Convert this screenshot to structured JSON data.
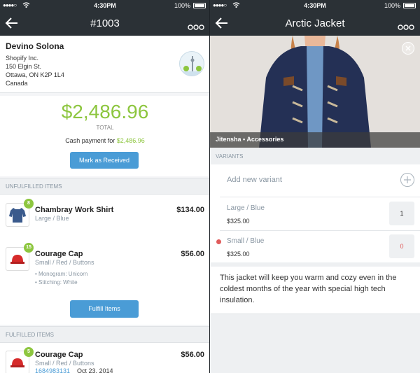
{
  "status": {
    "time": "4:30PM",
    "battery": "100%"
  },
  "left": {
    "nav_title": "#1003",
    "customer": {
      "name": "Devino Solona",
      "company": "Shopify Inc.",
      "street": "150 Elgin St.",
      "city": "Ottawa, ON K2P 1L4",
      "country": "Canada"
    },
    "total_amount": "$2,486.96",
    "total_label": "TOTAL",
    "cash_prefix": "Cash payment for",
    "cash_amount": "$2,486.96",
    "mark_received_label": "Mark as Received",
    "unfulfilled_heading": "UNFULFILLED ITEMS",
    "unfulfilled": [
      {
        "qty": "8",
        "name": "Chambray Work Shirt",
        "price": "$134.00",
        "variant": "Large / Blue"
      },
      {
        "qty": "15",
        "name": "Courage Cap",
        "price": "$56.00",
        "variant": "Small / Red / Buttons",
        "monogram": "• Monogram: Unicorn",
        "stitching": "• Stitching: White"
      }
    ],
    "fulfill_label": "Fulfill Items",
    "fulfilled_heading": "FULFILLED ITEMS",
    "fulfilled": [
      {
        "qty": "5",
        "name": "Courage Cap",
        "price": "$56.00",
        "variant": "Small / Red / Buttons",
        "tracking": "1684983131",
        "date": "Oct 23, 2014"
      }
    ]
  },
  "right": {
    "nav_title": "Arctic Jacket",
    "photo_caption": "Jitensha • Accessories",
    "variants_heading": "VARIANTS",
    "add_variant_label": "Add new variant",
    "variants": [
      {
        "name": "Large / Blue",
        "price": "$325.00",
        "qty": "1"
      },
      {
        "name": "Small / Blue",
        "price": "$325.00",
        "qty": "0"
      }
    ],
    "description": "This jacket will keep you warm and cozy even in the coldest months of the year with special high tech insulation."
  },
  "colors": {
    "accent_green": "#8dc63f",
    "button_blue": "#4a9cd6",
    "navbar": "#2b3136",
    "warning_red": "#e05b5b"
  },
  "icons": [
    "back-arrow-icon",
    "more-dots-icon",
    "map-pin-icon",
    "shirt-icon",
    "cap-icon",
    "close-icon",
    "plus-icon"
  ]
}
